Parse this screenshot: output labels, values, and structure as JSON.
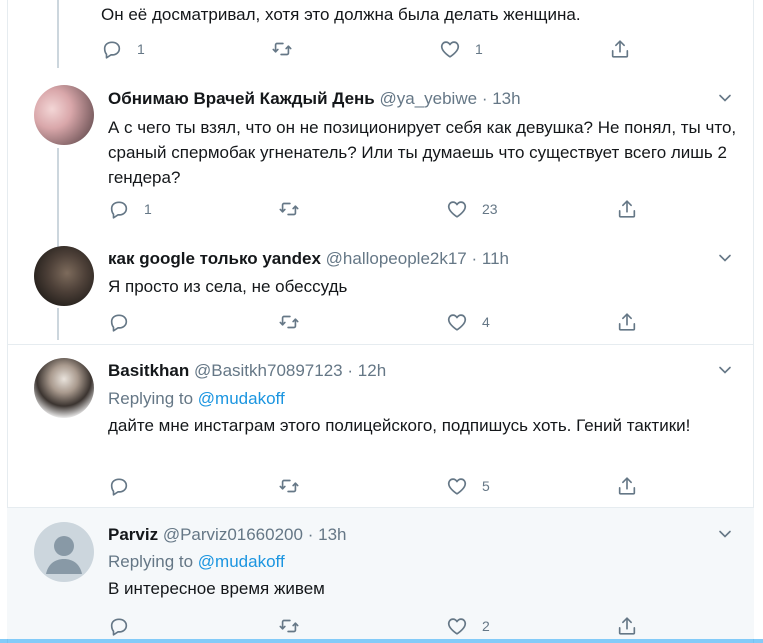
{
  "tweets": [
    {
      "text": "Он её досматривал, хотя это должна была делать женщина.",
      "reply_count": "1",
      "retweet_count": "",
      "like_count": "1"
    },
    {
      "name": "Обнимаю Врачей Каждый День",
      "handle": "@ya_yebiwe",
      "time": "13h",
      "text": "А с чего ты взял, что он не позиционирует себя как девушка? Не понял, ты что, сраный спермобак угненатель? Или ты думаешь что существует всего лишь 2 гендера?",
      "reply_count": "1",
      "retweet_count": "",
      "like_count": "23"
    },
    {
      "name": "как google только yandex",
      "handle": "@hallopeople2k17",
      "time": "11h",
      "text": "Я просто из села, не обессудь",
      "reply_count": "",
      "retweet_count": "",
      "like_count": "4"
    },
    {
      "name": "Basitkhan",
      "handle": "@Basitkh70897123",
      "time": "12h",
      "replying_prefix": "Replying to",
      "replying_mention": "@mudakoff",
      "text": "дайте мне инстаграм этого полицейского, подпишусь хоть. Гений тактики!",
      "reply_count": "",
      "retweet_count": "",
      "like_count": "5"
    },
    {
      "name": "Parviz",
      "handle": "@Parviz01660200",
      "time": "13h",
      "replying_prefix": "Replying to",
      "replying_mention": "@mudakoff",
      "text": "В интересное время живем",
      "reply_count": "",
      "retweet_count": "",
      "like_count": "2"
    }
  ],
  "separator": "·",
  "icons": {
    "reply": "reply-icon",
    "retweet": "retweet-icon",
    "like": "heart-icon",
    "share": "share-icon",
    "caret": "chevron-down-icon"
  },
  "colors": {
    "name": "#14171a",
    "secondary": "#657786",
    "link": "#1b95e0",
    "thread_line": "#ccd6dd",
    "border": "#e6ecf0",
    "alt_background": "#f5f8fa"
  }
}
